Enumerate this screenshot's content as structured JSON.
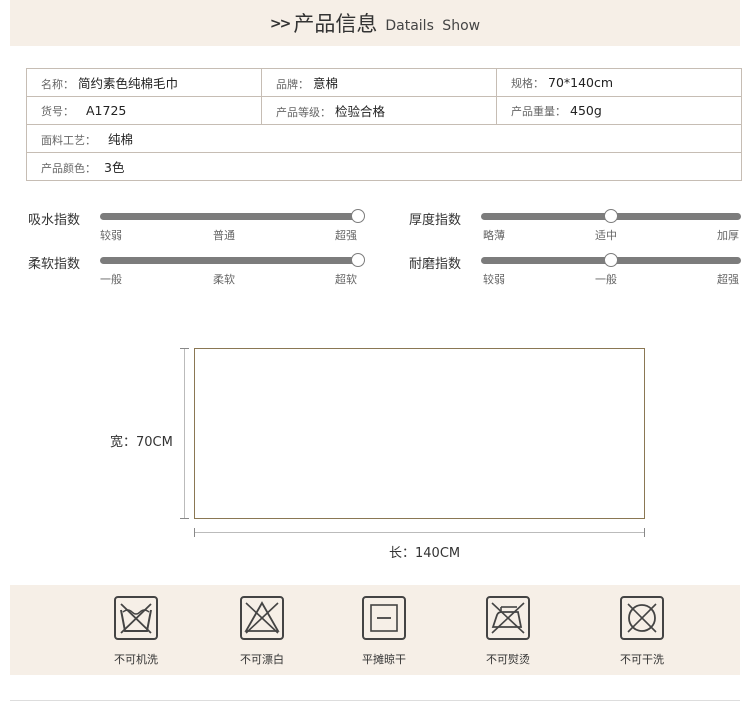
{
  "header": {
    "arrows": ">>",
    "title_cn": "产品信息",
    "title_en": "Datails Show"
  },
  "info": {
    "name_k": "名称：",
    "name_v": "简约素色纯棉毛巾",
    "brand_k": "品牌：",
    "brand_v": "意棉",
    "spec_k": "规格：",
    "spec_v": "70*140cm",
    "sku_k": "货号：",
    "sku_v": "A1725",
    "grade_k": "产品等级：",
    "grade_v": "检验合格",
    "weight_k": "产品重量：",
    "weight_v": "450g",
    "fabric_k": "面料工艺：",
    "fabric_v": "纯棉",
    "color_k": "产品颜色：",
    "color_v": "3色"
  },
  "sliders": [
    {
      "label": "吸水指数",
      "ticks": [
        "较弱",
        "普通",
        "超强"
      ],
      "level": 1.0
    },
    {
      "label": "厚度指数",
      "ticks": [
        "略薄",
        "适中",
        "加厚"
      ],
      "level": 0.5
    },
    {
      "label": "柔软指数",
      "ticks": [
        "一般",
        "柔软",
        "超软"
      ],
      "level": 1.0
    },
    {
      "label": "耐磨指数",
      "ticks": [
        "较弱",
        "一般",
        "超强"
      ],
      "level": 0.5
    }
  ],
  "diagram": {
    "width_label": "宽：70CM",
    "length_label": "长：140CM"
  },
  "care": [
    {
      "icon": "no-machine-wash-icon",
      "label": "不可机洗"
    },
    {
      "icon": "no-bleach-icon",
      "label": "不可漂白"
    },
    {
      "icon": "dry-flat-icon",
      "label": "平摊晾干"
    },
    {
      "icon": "no-iron-icon",
      "label": "不可熨烫"
    },
    {
      "icon": "no-dry-clean-icon",
      "label": "不可干洗"
    }
  ],
  "colors": {
    "band": "#f6efe7",
    "track": "#7c7c7c",
    "rect_border": "#8a7753",
    "icon_stroke": "#444444"
  }
}
